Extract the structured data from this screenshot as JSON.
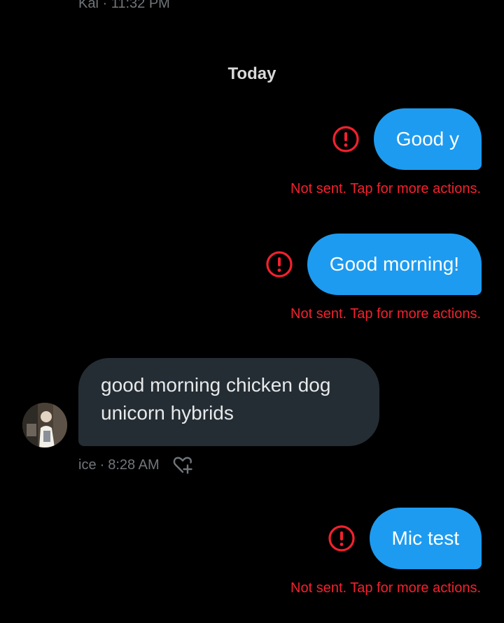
{
  "previous_message": {
    "sender": "Kai",
    "separator": "·",
    "time": "11:32 PM"
  },
  "date_divider": "Today",
  "outgoing_1": {
    "text": "Good y",
    "status": "Not sent. Tap for more actions.",
    "icon": "error-alert-icon"
  },
  "outgoing_2": {
    "text": "Good morning!",
    "status": "Not sent. Tap for more actions.",
    "icon": "error-alert-icon"
  },
  "incoming": {
    "line1": "good morning chicken dog",
    "line2": "unicorn hybrids",
    "sender": "ice",
    "separator": "·",
    "time": "8:28 AM",
    "react_icon": "add-reaction-heart-icon"
  },
  "outgoing_3": {
    "text": "Mic test",
    "status": "Not sent. Tap for more actions.",
    "icon": "error-alert-icon"
  },
  "colors": {
    "background": "#000000",
    "outgoing_bubble": "#1d9bf0",
    "incoming_bubble": "#252d34",
    "error": "#f4212e",
    "meta_text": "#71767b"
  }
}
